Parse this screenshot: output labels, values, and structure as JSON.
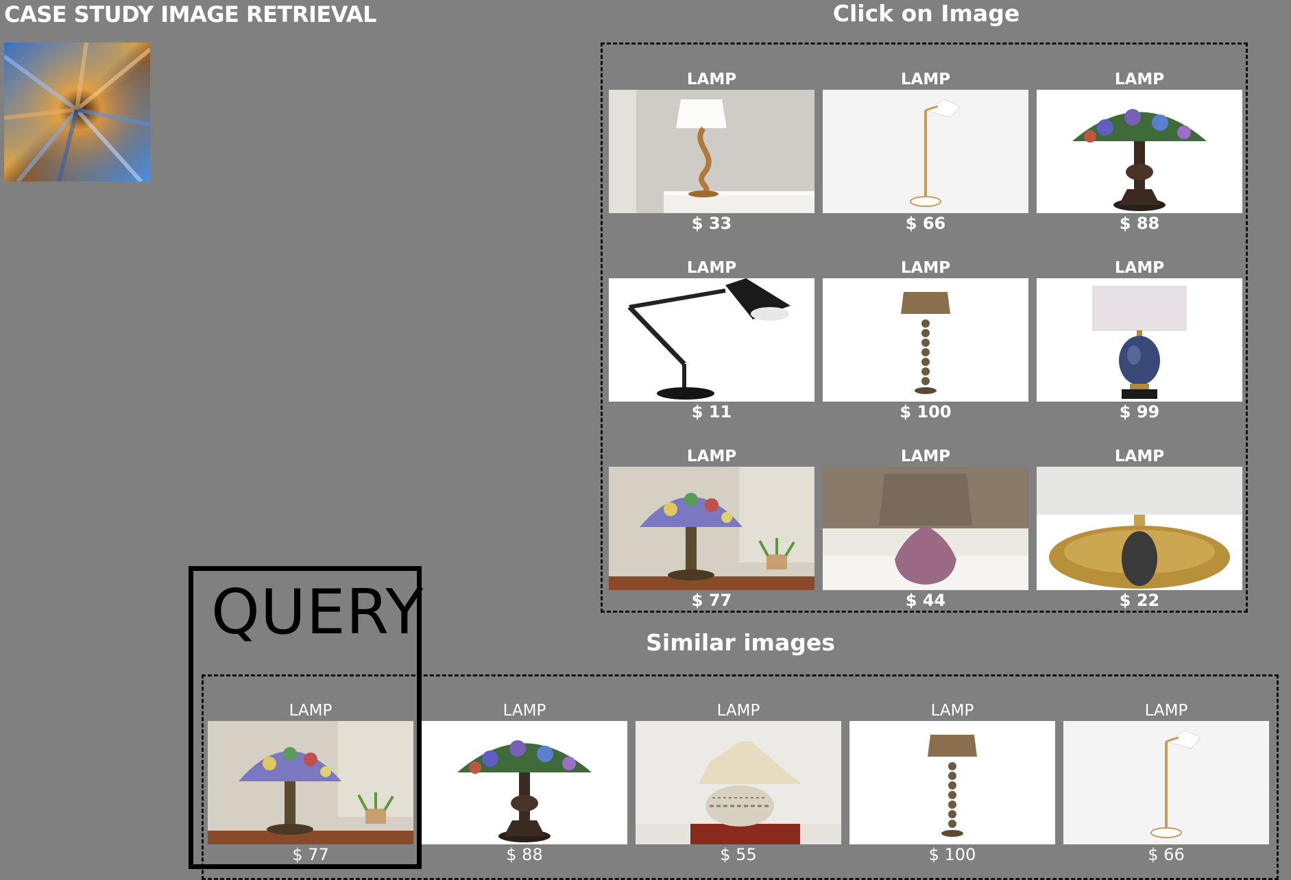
{
  "app": {
    "title": "CASE STUDY IMAGE RETRIEVAL"
  },
  "click_section": {
    "title": "Click on Image",
    "items": [
      {
        "label": "LAMP",
        "price": "$ 33",
        "icon": "table-lamp-s-curve-image",
        "bg": "#cfcbc6"
      },
      {
        "label": "LAMP",
        "price": "$ 66",
        "icon": "floor-lamp-brass-image",
        "bg": "#f4f4f4"
      },
      {
        "label": "LAMP",
        "price": "$ 88",
        "icon": "tiffany-lamp-roses-image",
        "bg": "#ffffff"
      },
      {
        "label": "LAMP",
        "price": "$ 11",
        "icon": "swing-arm-desk-lamp-image",
        "bg": "#ffffff"
      },
      {
        "label": "LAMP",
        "price": "$ 100",
        "icon": "spindle-floor-lamp-image",
        "bg": "#ffffff"
      },
      {
        "label": "LAMP",
        "price": "$ 99",
        "icon": "blue-ceramic-table-lamp-image",
        "bg": "#ffffff"
      },
      {
        "label": "LAMP",
        "price": "$ 77",
        "icon": "tiffany-lamp-room-image",
        "bg": "#d6d0c4"
      },
      {
        "label": "LAMP",
        "price": "$ 44",
        "icon": "purple-glass-lamp-image",
        "bg": "#dcd8d2"
      },
      {
        "label": "LAMP",
        "price": "$ 22",
        "icon": "gold-oval-lamp-image",
        "bg": "#ffffff"
      }
    ]
  },
  "query": {
    "label": "QUERY"
  },
  "similar_section": {
    "title": "Similar images",
    "items": [
      {
        "label": "LAMP",
        "price": "$ 77",
        "icon": "tiffany-lamp-room-image",
        "bg": "#d6d0c4"
      },
      {
        "label": "LAMP",
        "price": "$ 88",
        "icon": "tiffany-lamp-roses-image",
        "bg": "#ffffff"
      },
      {
        "label": "LAMP",
        "price": "$ 55",
        "icon": "ceramic-pot-lamp-image",
        "bg": "#e7e4de"
      },
      {
        "label": "LAMP",
        "price": "$ 100",
        "icon": "spindle-floor-lamp-image",
        "bg": "#ffffff"
      },
      {
        "label": "LAMP",
        "price": "$ 66",
        "icon": "floor-lamp-brass-image",
        "bg": "#f4f4f4"
      }
    ]
  }
}
